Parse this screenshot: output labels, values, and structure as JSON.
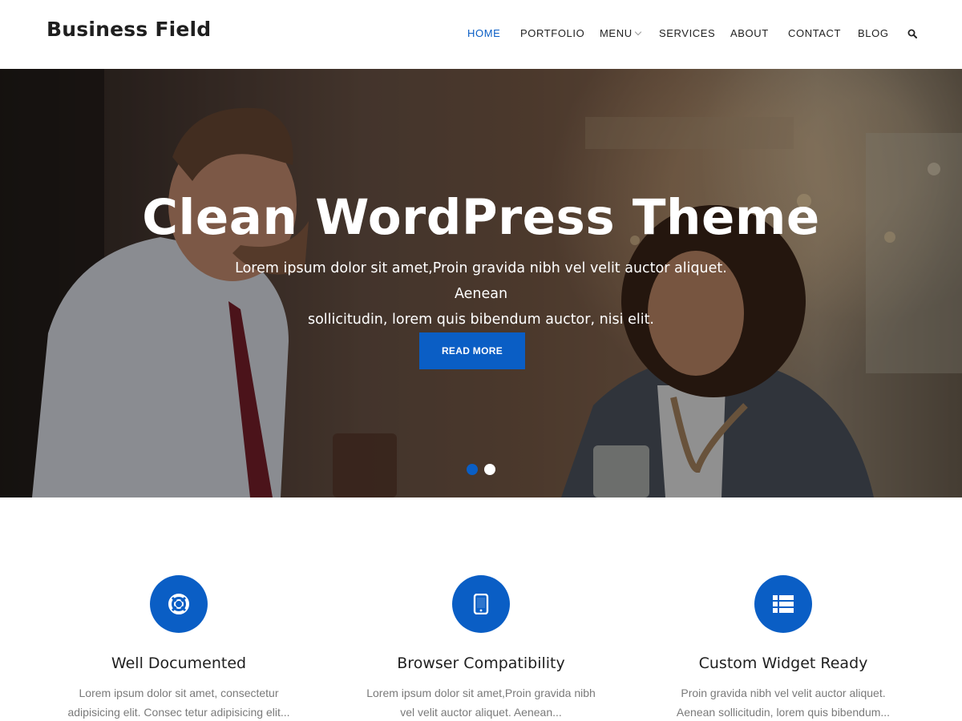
{
  "header": {
    "brand": "Business Field",
    "nav": [
      "HOME",
      "PORTFOLIO",
      "MENU",
      "SERVICES",
      "ABOUT",
      "CONTACT",
      "BLOG"
    ],
    "active_item": "HOME",
    "search_icon": "search-icon"
  },
  "hero": {
    "title": "Clean WordPress Theme",
    "subtitle_line1": "Lorem ipsum dolor sit amet,Proin gravida nibh vel velit auctor aliquet. Aenean",
    "subtitle_line2": "sollicitudin, lorem quis bibendum auctor, nisi elit.",
    "button_label": "READ MORE",
    "slides_total": 2,
    "active_slide": 1
  },
  "features": [
    {
      "icon": "lifebuoy-icon",
      "title": "Well Documented",
      "desc_line1": "Lorem ipsum dolor sit amet, consectetur",
      "desc_line2": "adipisicing elit. Consec tetur adipisicing elit..."
    },
    {
      "icon": "tablet-icon",
      "title": "Browser Compatibility",
      "desc_line1": "Lorem ipsum dolor sit amet,Proin gravida nibh",
      "desc_line2": "vel velit auctor aliquet. Aenean..."
    },
    {
      "icon": "list-icon",
      "title": "Custom Widget Ready",
      "desc_line1": "Proin gravida nibh vel velit auctor aliquet.",
      "desc_line2": "Aenean sollicitudin, lorem quis bibendum..."
    }
  ],
  "colors": {
    "accent": "#0a5ec5",
    "text_dark": "#1f1f1f",
    "text_muted": "#7a7a7a"
  }
}
